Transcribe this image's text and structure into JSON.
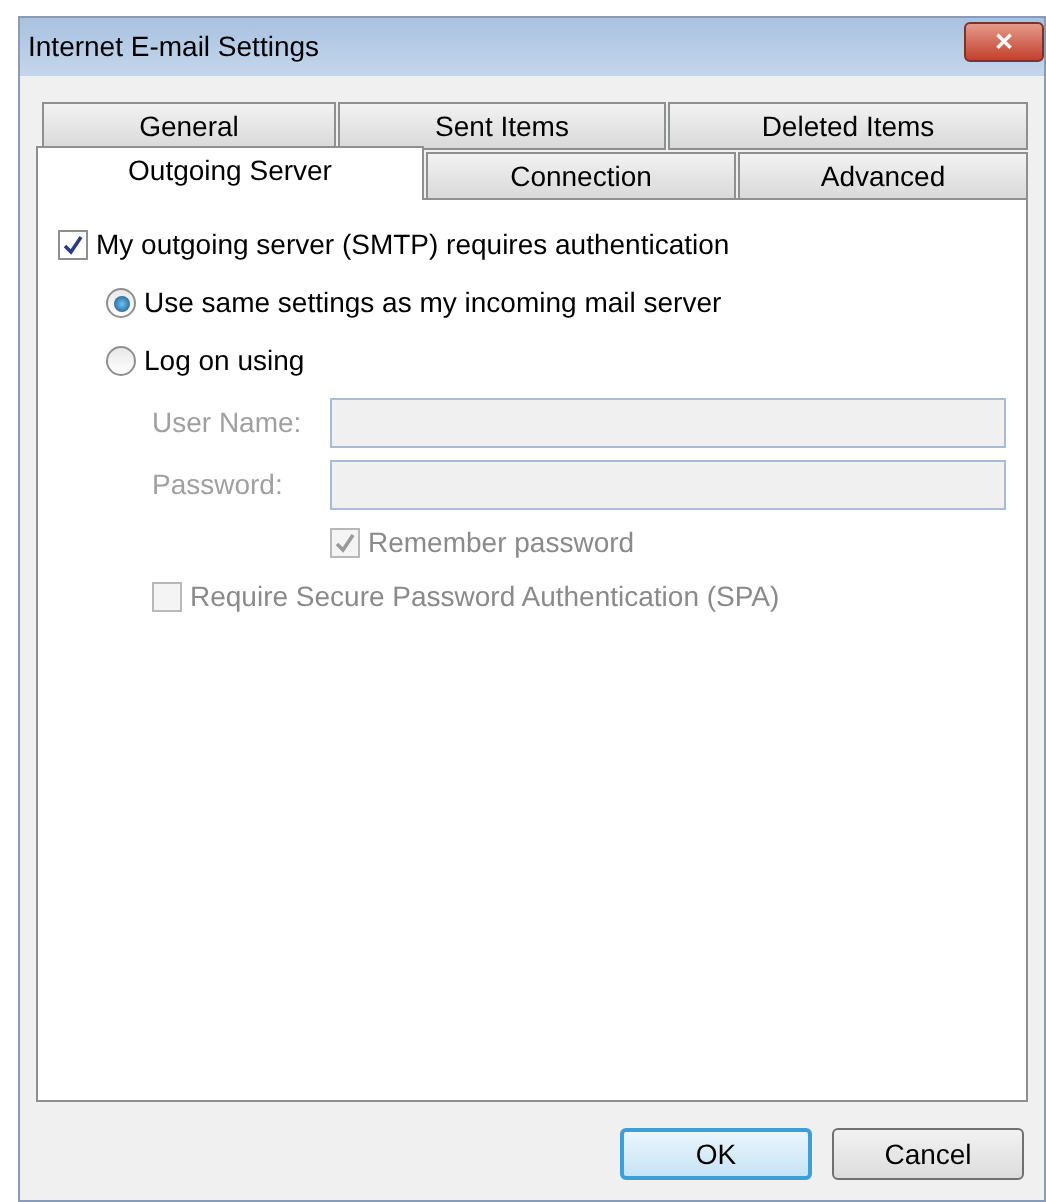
{
  "window": {
    "title": "Internet E-mail Settings",
    "close": "✕"
  },
  "tab_rows": [
    [
      {
        "label": "General",
        "selected": false
      },
      {
        "label": "Sent Items",
        "selected": false
      },
      {
        "label": "Deleted Items",
        "selected": false
      }
    ],
    [
      {
        "label": "Outgoing Server",
        "selected": true
      },
      {
        "label": "Connection",
        "selected": false
      },
      {
        "label": "Advanced",
        "selected": false
      }
    ]
  ],
  "auth": {
    "label": "My outgoing server (SMTP) requires authentication",
    "checked": true
  },
  "options": [
    {
      "label": "Use same settings as my incoming mail server",
      "selected": true
    },
    {
      "label": "Log on using",
      "selected": false
    }
  ],
  "fields": [
    {
      "label": "User Name:",
      "disabled": true
    },
    {
      "label": "Password:",
      "disabled": true
    }
  ],
  "remember": {
    "label": "Remember password",
    "checked": true,
    "disabled": true
  },
  "spa": {
    "label": "Require Secure Password Authentication (SPA)",
    "checked": false,
    "disabled": true
  },
  "buttons": [
    {
      "label": "OK",
      "default": true
    },
    {
      "label": "Cancel",
      "default": false
    }
  ]
}
